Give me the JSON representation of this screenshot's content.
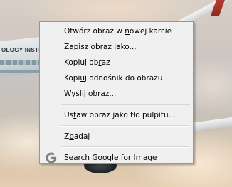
{
  "background": {
    "fuselage_text": "OLOGY INSTITUTE"
  },
  "context_menu": {
    "items": [
      {
        "id": "open-image-new-tab",
        "pre": "Otwórz obraz w ",
        "acc": "n",
        "post": "owej karcie"
      },
      {
        "id": "save-image-as",
        "pre": "",
        "acc": "Z",
        "post": "apisz obraz jako..."
      },
      {
        "id": "copy-image",
        "pre": "Kopiuj ob",
        "acc": "r",
        "post": "az"
      },
      {
        "id": "copy-image-link",
        "pre": "Kopi",
        "acc": "u",
        "post": "j odnośnik do obrazu"
      },
      {
        "id": "send-image",
        "pre": "Wyś",
        "acc": "l",
        "post": "ij obraz..."
      },
      {
        "id": "set-as-desktop-background",
        "pre": "Us",
        "acc": "t",
        "post": "aw obraz jako tło pulpitu..."
      },
      {
        "id": "inspect",
        "pre": "Z",
        "acc": "b",
        "post": "adaj"
      },
      {
        "id": "search-google-for-image",
        "pre": "Search Google for Image",
        "acc": "",
        "post": ""
      }
    ],
    "search_icon": "google-g-icon",
    "colors": {
      "menu_bg": "#f0f0f0",
      "menu_border": "#979797",
      "google_blue": "#4285f4",
      "google_red": "#ea4335",
      "google_yellow": "#fbbc05",
      "google_green": "#34a853"
    }
  }
}
